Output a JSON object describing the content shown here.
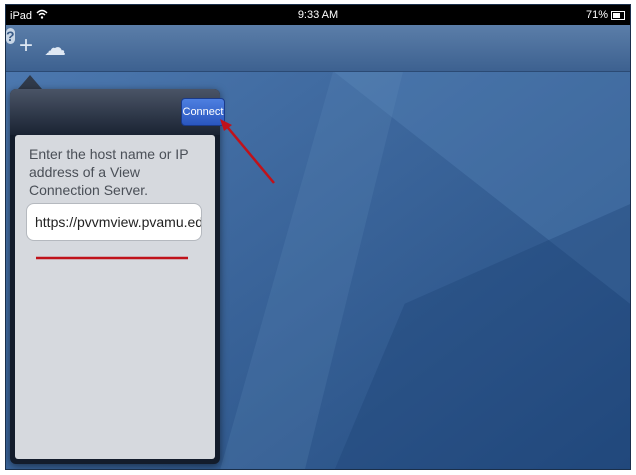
{
  "status_bar": {
    "device": "iPad",
    "wifi_icon": "wifi-icon",
    "time": "9:33 AM",
    "battery_text": "71%",
    "battery_icon": "battery-icon"
  },
  "toolbar": {
    "add_icon": "plus-icon",
    "add_glyph": "+",
    "cloud_icon": "cloud-icon",
    "cloud_glyph": "☁",
    "help_icon": "help-icon",
    "help_glyph": "?"
  },
  "popover": {
    "connect_label": "Connect",
    "instruction": "Enter the host name or IP address of a View Connection Server.",
    "host_value": "https://pvvmview.pvamu.edu"
  },
  "colors": {
    "wallpaper": "#2f5f96",
    "connect_button": "#2e5fd0",
    "annotation": "#c0121a"
  }
}
